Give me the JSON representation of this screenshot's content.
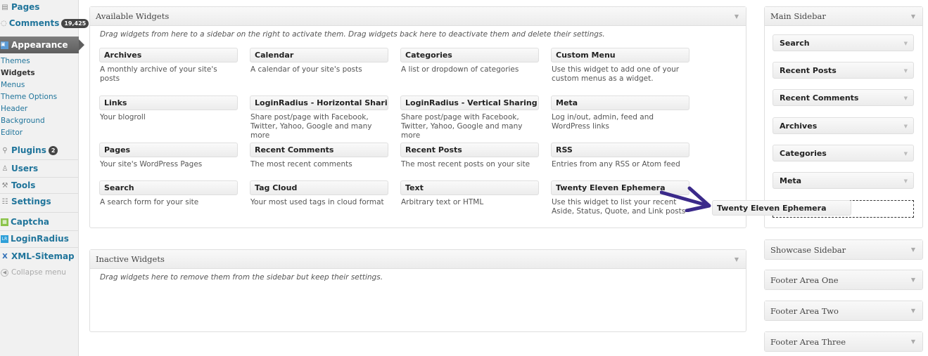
{
  "menu": {
    "pages": "Pages",
    "comments": "Comments",
    "comments_count": "19,425",
    "appearance": "Appearance",
    "submenu": [
      "Themes",
      "Widgets",
      "Menus",
      "Theme Options",
      "Header",
      "Background",
      "Editor"
    ],
    "plugins": "Plugins",
    "plugins_count": "2",
    "users": "Users",
    "tools": "Tools",
    "settings": "Settings",
    "captcha": "Captcha",
    "loginradius": "LoginRadius",
    "xml_sitemap": "XML-Sitemap",
    "collapse": "Collapse menu"
  },
  "available": {
    "title": "Available Widgets",
    "description": "Drag widgets from here to a sidebar on the right to activate them. Drag widgets back here to deactivate them and delete their settings.",
    "widgets": [
      {
        "title": "Archives",
        "desc": "A monthly archive of your site's posts"
      },
      {
        "title": "Calendar",
        "desc": "A calendar of your site's posts"
      },
      {
        "title": "Categories",
        "desc": "A list or dropdown of categories"
      },
      {
        "title": "Custom Menu",
        "desc": "Use this widget to add one of your custom menus as a widget."
      },
      {
        "title": "Links",
        "desc": "Your blogroll"
      },
      {
        "title": "LoginRadius - Horizontal Sharing",
        "desc": "Share post/page with Facebook, Twitter, Yahoo, Google and many more"
      },
      {
        "title": "LoginRadius - Vertical Sharing",
        "desc": "Share post/page with Facebook, Twitter, Yahoo, Google and many more"
      },
      {
        "title": "Meta",
        "desc": "Log in/out, admin, feed and WordPress links"
      },
      {
        "title": "Pages",
        "desc": "Your site's WordPress Pages"
      },
      {
        "title": "Recent Comments",
        "desc": "The most recent comments"
      },
      {
        "title": "Recent Posts",
        "desc": "The most recent posts on your site"
      },
      {
        "title": "RSS",
        "desc": "Entries from any RSS or Atom feed"
      },
      {
        "title": "Search",
        "desc": "A search form for your site"
      },
      {
        "title": "Tag Cloud",
        "desc": "Your most used tags in cloud format"
      },
      {
        "title": "Text",
        "desc": "Arbitrary text or HTML"
      },
      {
        "title": "Twenty Eleven Ephemera",
        "desc": "Use this widget to list your recent Aside, Status, Quote, and Link posts"
      }
    ]
  },
  "inactive": {
    "title": "Inactive Widgets",
    "description": "Drag widgets here to remove them from the sidebar but keep their settings."
  },
  "main_sidebar": {
    "title": "Main Sidebar",
    "widgets": [
      "Search",
      "Recent Posts",
      "Recent Comments",
      "Archives",
      "Categories",
      "Meta"
    ]
  },
  "dragging": "Twenty Eleven Ephemera",
  "other_sidebars": [
    "Showcase Sidebar",
    "Footer Area One",
    "Footer Area Two",
    "Footer Area Three"
  ]
}
